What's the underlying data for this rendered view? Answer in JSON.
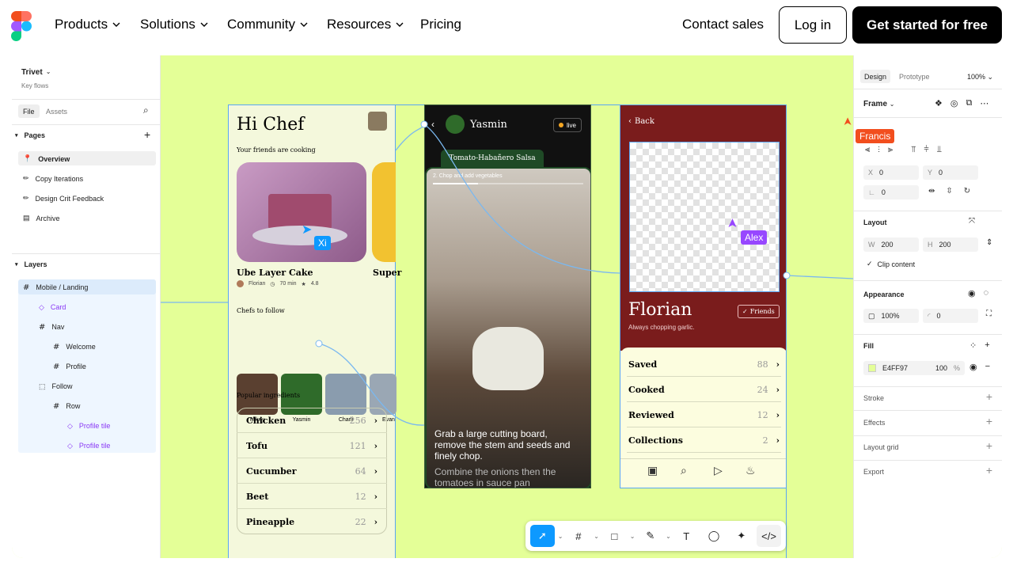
{
  "nav": {
    "items": [
      "Products",
      "Solutions",
      "Community",
      "Resources",
      "Pricing"
    ],
    "contact": "Contact sales",
    "login": "Log in",
    "cta": "Get started for free"
  },
  "left_panel": {
    "file_name": "Trivet",
    "file_sub": "Key flows",
    "tab_file": "File",
    "tab_assets": "Assets",
    "pages_label": "Pages",
    "pages": [
      "Overview",
      "Copy Iterations",
      "Design Crit Feedback",
      "Archive"
    ],
    "layers_label": "Layers",
    "layers": [
      "Mobile / Landing",
      "Card",
      "Nav",
      "Welcome",
      "Profile",
      "Follow",
      "Row",
      "Profile tile",
      "Profile tile"
    ]
  },
  "frame1": {
    "title": "Hi Chef",
    "subtitle": "Your friends are cooking",
    "card_title": "Ube Layer Cake",
    "card_meta_author": "Florian",
    "card_meta_time": "70 min",
    "card_meta_rating": "4.8",
    "card2_title": "Super",
    "chefs_label": "Chefs to follow",
    "chefs": [
      "Mikey",
      "Yasmin",
      "Charli",
      "Evan"
    ],
    "ingredients_label": "Popular ingredients",
    "ingredients": [
      {
        "name": "Chicken",
        "count": "256"
      },
      {
        "name": "Tofu",
        "count": "121"
      },
      {
        "name": "Cucumber",
        "count": "64"
      },
      {
        "name": "Beet",
        "count": "12"
      },
      {
        "name": "Pineapple",
        "count": "22"
      }
    ]
  },
  "frame2": {
    "user": "Yasmin",
    "live": "live",
    "recipe": "Tomato-Habañero Salsa",
    "step": "2.  Chop and add vegetables",
    "caption": "Grab a large cutting board, remove the stem and seeds and finely chop.",
    "caption2": "Combine the onions then the tomatoes in sauce pan"
  },
  "frame3": {
    "back": "Back",
    "name": "Florian",
    "tagline": "Always chopping garlic.",
    "badge": "Friends",
    "stats": [
      {
        "label": "Saved",
        "count": "88"
      },
      {
        "label": "Cooked",
        "count": "24"
      },
      {
        "label": "Reviewed",
        "count": "12"
      },
      {
        "label": "Collections",
        "count": "2"
      }
    ]
  },
  "cursors": {
    "xi": "Xi",
    "alex": "Alex",
    "francis": "Francis"
  },
  "right_panel": {
    "tab_design": "Design",
    "tab_prototype": "Prototype",
    "zoom": "100%",
    "frame_label": "Frame",
    "x": "0",
    "y": "0",
    "rot": "0",
    "layout_label": "Layout",
    "w": "200",
    "h": "200",
    "clip": "Clip content",
    "appearance_label": "Appearance",
    "opacity": "100%",
    "radius": "0",
    "fill_label": "Fill",
    "fill_hex": "E4FF97",
    "fill_opacity": "100",
    "fill_pct": "%",
    "stroke": "Stroke",
    "effects": "Effects",
    "layout_grid": "Layout grid",
    "export": "Export",
    "x_lbl": "X",
    "y_lbl": "Y",
    "w_lbl": "W",
    "h_lbl": "H"
  },
  "colors": {
    "canvas": "#e4ff97",
    "accent": "#0d99ff",
    "frame3_header": "#7a1c1c",
    "alex": "#9747ff",
    "francis": "#f24e1e"
  }
}
